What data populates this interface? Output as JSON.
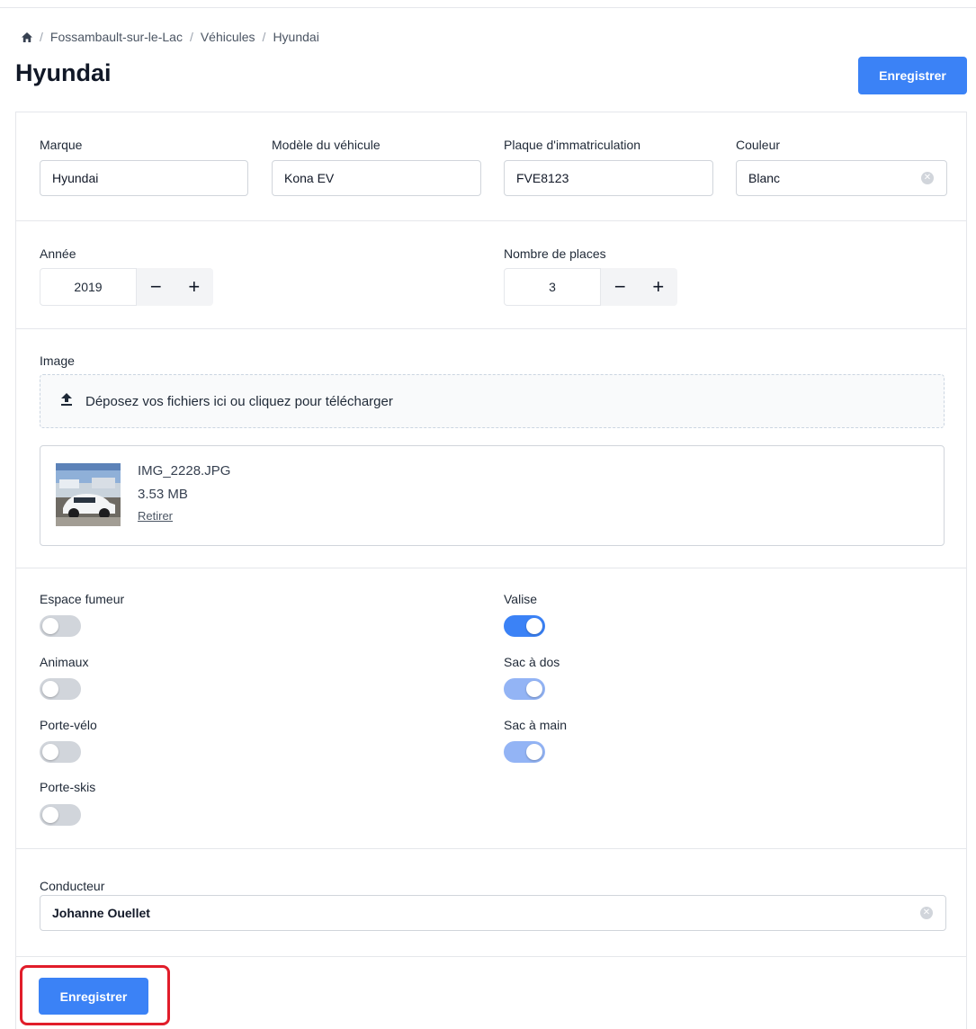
{
  "breadcrumb": {
    "items": [
      "Fossambault-sur-le-Lac",
      "Véhicules",
      "Hyundai"
    ],
    "separator": "/"
  },
  "page": {
    "title": "Hyundai"
  },
  "actions": {
    "save_label": "Enregistrer"
  },
  "vehicle": {
    "brand": {
      "label": "Marque",
      "value": "Hyundai"
    },
    "model": {
      "label": "Modèle du véhicule",
      "value": "Kona EV"
    },
    "plate": {
      "label": "Plaque d'immatriculation",
      "value": "FVE8123"
    },
    "color": {
      "label": "Couleur",
      "value": "Blanc"
    },
    "year": {
      "label": "Année",
      "value": "2019"
    },
    "seats": {
      "label": "Nombre de places",
      "value": "3"
    }
  },
  "stepper": {
    "minus": "−",
    "plus": "+"
  },
  "image": {
    "label": "Image",
    "dropzone_text": "Déposez vos fichiers ici ou cliquez pour télécharger",
    "file": {
      "name": "IMG_2228.JPG",
      "size": "3.53 MB",
      "remove_label": "Retirer"
    }
  },
  "options": {
    "espace_fumeur": {
      "label": "Espace fumeur",
      "on": false
    },
    "animaux": {
      "label": "Animaux",
      "on": false
    },
    "porte_velo": {
      "label": "Porte-vélo",
      "on": false
    },
    "porte_skis": {
      "label": "Porte-skis",
      "on": false
    },
    "valise": {
      "label": "Valise",
      "on": true
    },
    "sac_a_dos": {
      "label": "Sac à dos",
      "on": true
    },
    "sac_a_main": {
      "label": "Sac à main",
      "on": true
    }
  },
  "driver": {
    "label": "Conducteur",
    "value": "Johanne Ouellet"
  },
  "colors": {
    "accent": "#3b82f6",
    "accent_light": "#93b4f5",
    "highlight": "#e11d2a"
  }
}
